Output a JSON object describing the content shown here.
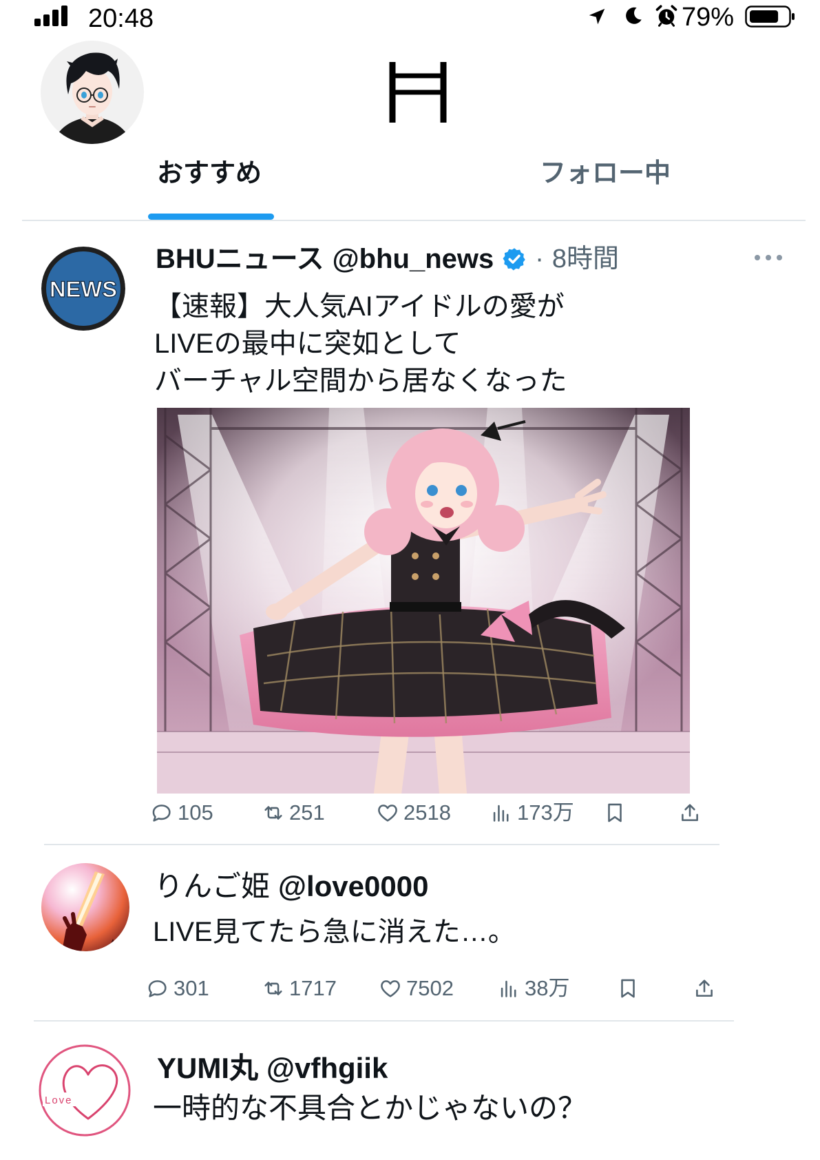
{
  "status_bar": {
    "time": "20:48",
    "battery_text": "79%",
    "battery_level": 0.79,
    "icons": [
      "signal-icon",
      "location-icon",
      "moon-icon",
      "alarm-icon",
      "battery-icon"
    ]
  },
  "header": {
    "logo": "H",
    "avatar": "profile-avatar"
  },
  "tabs": [
    {
      "label": "おすすめ",
      "active": true
    },
    {
      "label": "フォロー中",
      "active": false
    }
  ],
  "colors": {
    "accent": "#1d9bf0",
    "text": "#0f1419",
    "muted": "#536471",
    "divider": "#e1e6ea"
  },
  "posts": [
    {
      "display_name": "BHUニュース",
      "handle": "@bhu_news",
      "verified": true,
      "separator": "·",
      "time": "8時間",
      "avatar_text": "NEWS",
      "text_lines": [
        "【速報】大人気AIアイドルの愛が",
        "LIVEの最中に突如として",
        "バーチャル空間から居なくなった"
      ],
      "image": "idol-on-stage-illustration",
      "actions": [
        {
          "icon": "reply-icon",
          "count": "105"
        },
        {
          "icon": "repost-icon",
          "count": "251"
        },
        {
          "icon": "like-icon",
          "count": "2518"
        },
        {
          "icon": "views-icon",
          "count": "173万"
        },
        {
          "icon": "bookmark-icon"
        },
        {
          "icon": "share-icon"
        }
      ]
    },
    {
      "display_name": "りんご姫",
      "handle": "@love0000",
      "text": "LIVE見てたら急に消えた…。",
      "actions": [
        {
          "icon": "reply-icon",
          "count": "301"
        },
        {
          "icon": "repost-icon",
          "count": "1717"
        },
        {
          "icon": "like-icon",
          "count": "7502"
        },
        {
          "icon": "views-icon",
          "count": "38万"
        },
        {
          "icon": "bookmark-icon"
        },
        {
          "icon": "share-icon"
        }
      ]
    },
    {
      "display_name": "YUMI丸",
      "handle": "@vfhgiik",
      "avatar_text": "Love",
      "text": "一時的な不具合とかじゃないの？"
    }
  ]
}
